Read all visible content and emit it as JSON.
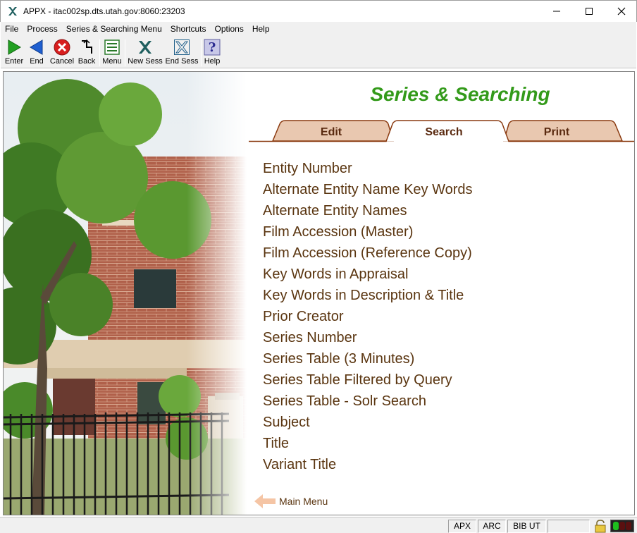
{
  "window": {
    "title": "APPX - itac002sp.dts.utah.gov:8060:23203"
  },
  "menubar": {
    "items": [
      "File",
      "Process",
      "Series & Searching Menu",
      "Shortcuts",
      "Options",
      "Help"
    ]
  },
  "toolbar": {
    "buttons": [
      {
        "label": "Enter",
        "icon": "green-play-icon"
      },
      {
        "label": "End",
        "icon": "blue-back-arrow-icon"
      },
      {
        "label": "Cancel",
        "icon": "red-cancel-icon"
      },
      {
        "label": "Back",
        "icon": "back-corner-arrow-icon"
      },
      {
        "label": "Menu",
        "icon": "menu-list-icon"
      },
      {
        "label": "New Sess",
        "icon": "new-session-icon"
      },
      {
        "label": "End Sess",
        "icon": "end-session-icon"
      },
      {
        "label": "Help",
        "icon": "help-question-icon"
      }
    ]
  },
  "page": {
    "heading": "Series & Searching",
    "tabs": [
      {
        "label": "Edit",
        "active": false
      },
      {
        "label": "Search",
        "active": true
      },
      {
        "label": "Print",
        "active": false
      }
    ],
    "items": [
      "Entity Number",
      "Alternate Entity Name Key Words",
      "Alternate Entity Names",
      "Film Accession (Master)",
      "Film Accession (Reference Copy)",
      "Key Words in Appraisal",
      "Key Words in Description & Title",
      "Prior Creator",
      "Series Number",
      "Series Table (3 Minutes)",
      "Series Table Filtered by Query",
      "Series Table - Solr Search",
      "Subject",
      "Title",
      "Variant Title"
    ],
    "main_menu_label": "Main Menu"
  },
  "statusbar": {
    "cells": [
      "APX",
      "ARC",
      "BIB UT"
    ]
  },
  "colors": {
    "heading": "#339a1a",
    "tab_fill": "#e9c8b0",
    "tab_border": "#8a3a10",
    "item_text": "#5a3510",
    "arrow": "#f5c5a5"
  }
}
